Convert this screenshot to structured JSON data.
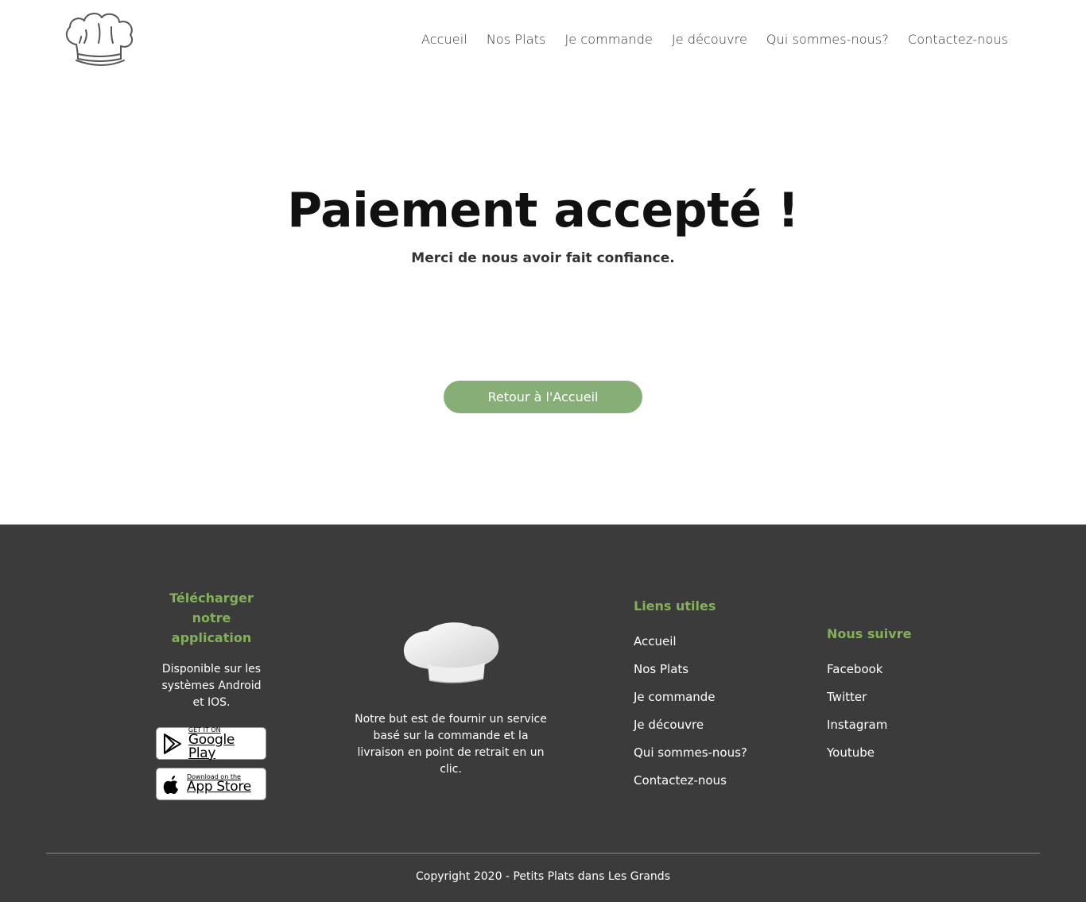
{
  "header": {
    "logo_icon": "chef-hat-outline-icon",
    "nav": [
      {
        "label": "Accueil"
      },
      {
        "label": "Nos Plats"
      },
      {
        "label": "Je commande"
      },
      {
        "label": "Je découvre"
      },
      {
        "label": "Qui sommes-nous?"
      },
      {
        "label": "Contactez-nous"
      }
    ]
  },
  "main": {
    "title": "Paiement accepté !",
    "subtitle": "Merci de nous avoir fait confiance.",
    "button_label": "Retour à l'Accueil"
  },
  "footer": {
    "app": {
      "title": "Télécharger notre application",
      "description": "Disponible sur les systèmes Android et IOS.",
      "google_small": "GET IT ON",
      "google_big": "Google Play",
      "apple_small": "Download on the",
      "apple_big": "App Store"
    },
    "about": {
      "image_icon": "chef-hat-icon",
      "text": "Notre but est de fournir un service basé sur la commande et la livraison en point de retrait en un clic."
    },
    "links": {
      "title": "Liens utiles",
      "items": [
        {
          "label": "Accueil"
        },
        {
          "label": "Nos Plats"
        },
        {
          "label": "Je commande"
        },
        {
          "label": "Je découvre"
        },
        {
          "label": "Qui sommes-nous?"
        },
        {
          "label": "Contactez-nous"
        }
      ]
    },
    "social": {
      "title": "Nous suivre",
      "items": [
        {
          "label": "Facebook"
        },
        {
          "label": "Twitter"
        },
        {
          "label": "Instagram"
        },
        {
          "label": "Youtube"
        }
      ]
    },
    "copyright": "Copyright 2020 - Petits Plats dans Les Grands"
  },
  "colors": {
    "accent_green": "#84b05a",
    "button_green": "#88ae78",
    "footer_bg": "#3b3b3b"
  }
}
